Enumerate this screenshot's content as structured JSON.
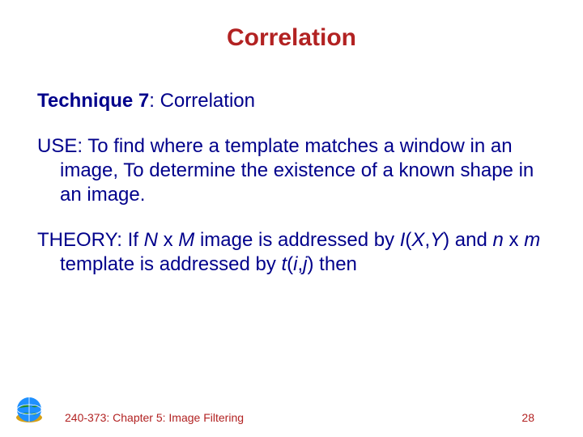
{
  "title": "Correlation",
  "technique": {
    "label": "Technique 7",
    "rest": ": Correlation"
  },
  "use": {
    "label": "USE:",
    "text": "  To find where a template matches a window in an image, To determine the existence of a known shape in an image."
  },
  "theory": {
    "label": "THEORY:",
    "a": " If ",
    "N": "N",
    "b": " x ",
    "M": "M",
    "c": " image is addressed by ",
    "I": "I",
    "open": "(",
    "X": "X",
    "comma": ",",
    "Y": "Y",
    "close": ")",
    "d": " and ",
    "nsmall": "n",
    "e": " x ",
    "msmall": "m",
    "f": " template is addressed by ",
    "tsmall": "t",
    "open2": "(",
    "ismall": "i",
    "comma2": ",",
    "jsmall": "j",
    "close2": ")",
    "g": " then"
  },
  "footer": {
    "left": "240-373: Chapter 5: Image Filtering",
    "right": "28"
  }
}
